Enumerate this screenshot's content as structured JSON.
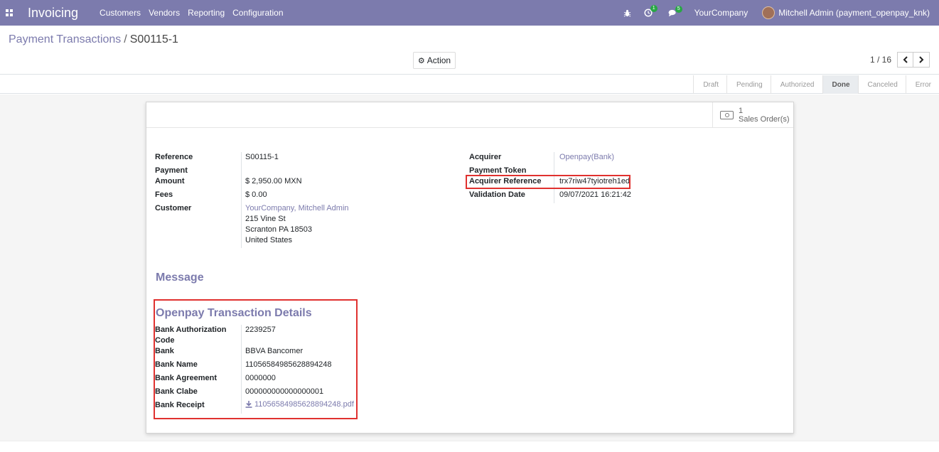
{
  "navbar": {
    "app_title": "Invoicing",
    "menu": [
      "Customers",
      "Vendors",
      "Reporting",
      "Configuration"
    ],
    "activity_count": "1",
    "messages_count": "5",
    "company": "YourCompany",
    "user": "Mitchell Admin (payment_openpay_knk)"
  },
  "control_panel": {
    "breadcrumb_parent": "Payment Transactions",
    "breadcrumb_separator": "/",
    "breadcrumb_current": "S00115-1",
    "action_label": "Action",
    "pager": "1 / 16"
  },
  "statusbar": {
    "steps": [
      "Draft",
      "Pending",
      "Authorized",
      "Done",
      "Canceled",
      "Error"
    ],
    "active": "Done"
  },
  "smart_button": {
    "count": "1",
    "label": "Sales Order(s)"
  },
  "left_fields": {
    "reference_label": "Reference",
    "reference": "S00115-1",
    "amount_label_1": "Payment",
    "amount_label_2": "Amount",
    "amount": "$ 2,950.00",
    "currency": "MXN",
    "fees_label": "Fees",
    "fees": "$ 0.00",
    "customer_label": "Customer",
    "customer_name": "YourCompany, Mitchell Admin",
    "address_1": "215 Vine St",
    "address_2": "Scranton PA 18503",
    "address_3": "United States"
  },
  "right_fields": {
    "acquirer_label": "Acquirer",
    "acquirer": "Openpay(Bank)",
    "token_label": "Payment Token",
    "acq_ref_label": "Acquirer Reference",
    "acq_ref": "trx7riw47tyiotreh1ed",
    "validation_label": "Validation Date",
    "validation": "09/07/2021 16:21:42"
  },
  "message_title": "Message",
  "openpay": {
    "title": "Openpay Transaction Details",
    "auth_label_1": "Bank Authorization",
    "auth_label_2": "Code",
    "auth": "2239257",
    "bank_label": "Bank",
    "bank": "BBVA Bancomer",
    "bank_name_label": "Bank Name",
    "bank_name": "11056584985628894248",
    "agreement_label": "Bank Agreement",
    "agreement": "0000000",
    "clabe_label": "Bank Clabe",
    "clabe": "000000000000000001",
    "receipt_label": "Bank Receipt",
    "receipt": "11056584985628894248.pdf"
  }
}
